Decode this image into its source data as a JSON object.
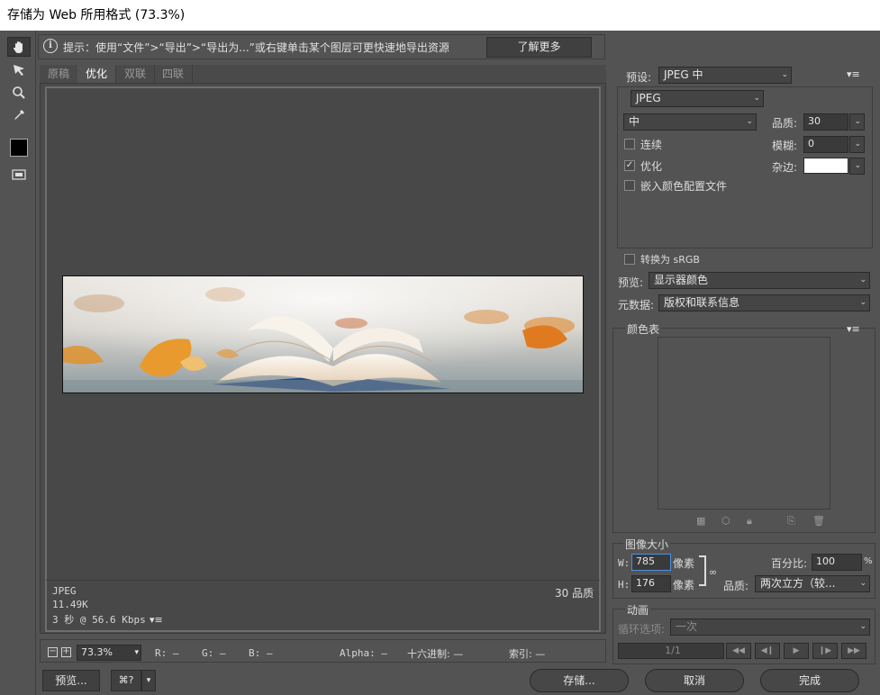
{
  "window": {
    "title": "存储为 Web 所用格式 (73.3%)"
  },
  "hint": {
    "text": "提示：使用“文件”>“导出”>“导出为...”或右键单击某个图层可更快速地导出资源",
    "learn_more": "了解更多"
  },
  "tools": [
    "hand-icon",
    "slice-select-icon",
    "zoom-icon",
    "eyedropper-icon",
    "color-swatch-icon",
    "toggle-slices-icon"
  ],
  "tabs": [
    "原稿",
    "优化",
    "双联",
    "四联"
  ],
  "preview_info": {
    "format": "JPEG",
    "size": "11.49K",
    "time": "3 秒 @ 56.6 Kbps",
    "quality": "30 品质"
  },
  "status": {
    "zoom": "73.3%",
    "r": "R: —",
    "g": "G: —",
    "b": "B: —",
    "alpha": "Alpha: —",
    "hex": "十六进制: —",
    "index": "索引: —"
  },
  "bottom_buttons": {
    "preview": "预览...",
    "save": "存储...",
    "cancel": "取消",
    "done": "完成"
  },
  "settings": {
    "preset_label": "预设:",
    "preset_value": "JPEG 中",
    "format_value": "JPEG",
    "quality_level": "中",
    "quality_label": "品质:",
    "quality_value": "30",
    "progressive_label": "连续",
    "blur_label": "模糊:",
    "blur_value": "0",
    "optimized_label": "优化",
    "matte_label": "杂边:",
    "embed_label": "嵌入颜色配置文件",
    "srgb_label": "转换为 sRGB",
    "preview_label": "预览:",
    "preview_value": "显示器颜色",
    "metadata_label": "元数据:",
    "metadata_value": "版权和联系信息"
  },
  "color_table": {
    "title": "颜色表"
  },
  "image_size": {
    "title": "图像大小",
    "w_label": "W:",
    "w_value": "785",
    "h_label": "H:",
    "h_value": "176",
    "px1": "像素",
    "px2": "像素",
    "percent_label": "百分比:",
    "percent_value": "100",
    "percent_unit": "%",
    "quality_label": "品质:",
    "quality_value": "两次立方（较..."
  },
  "animation": {
    "title": "动画",
    "loop_label": "循环选项:",
    "loop_value": "一次",
    "frame": "1/1"
  },
  "colors": {
    "accent_focus": "#4a90e2",
    "matte": "#ffffff"
  }
}
